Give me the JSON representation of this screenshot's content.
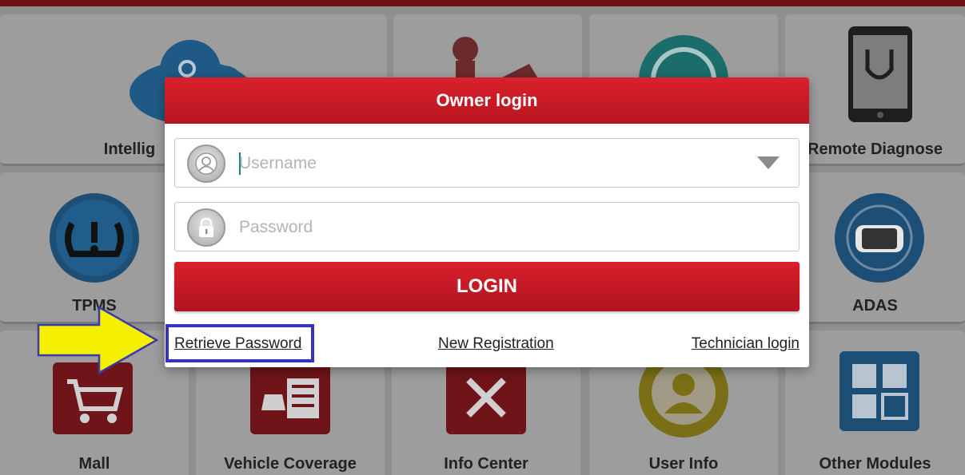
{
  "tiles": {
    "intelligent": "Intellig",
    "remote_diagnose": "Remote Diagnose",
    "tpms": "TPMS",
    "adas": "ADAS",
    "mall": "Mall",
    "vehicle_coverage": "Vehicle Coverage",
    "info_center": "Info Center",
    "user_info": "User Info",
    "other_modules": "Other Modules"
  },
  "dialog": {
    "title": "Owner login",
    "username_placeholder": "Username",
    "password_placeholder": "Password",
    "login_label": "LOGIN",
    "retrieve_password": "Retrieve Password",
    "new_registration": "New Registration",
    "technician_login": "Technician login"
  },
  "icons": {
    "user": "user-icon",
    "lock": "lock-icon",
    "dropdown": "chevron-down-icon"
  },
  "colors": {
    "accent_red": "#c81b25",
    "highlight_blue": "#3333bb",
    "arrow_yellow": "#f5f000"
  }
}
